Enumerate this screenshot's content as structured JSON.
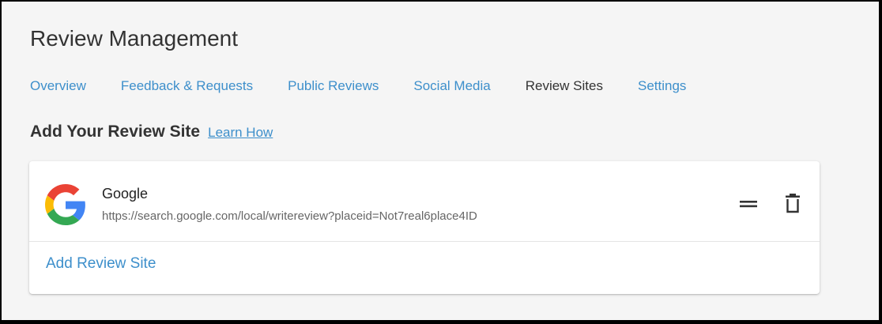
{
  "page": {
    "title": "Review Management"
  },
  "tabs": [
    {
      "label": "Overview",
      "active": false
    },
    {
      "label": "Feedback & Requests",
      "active": false
    },
    {
      "label": "Public Reviews",
      "active": false
    },
    {
      "label": "Social Media",
      "active": false
    },
    {
      "label": "Review Sites",
      "active": true
    },
    {
      "label": "Settings",
      "active": false
    }
  ],
  "section": {
    "title": "Add Your Review Site",
    "learn_link": "Learn How"
  },
  "review_sites": [
    {
      "name": "Google",
      "url": "https://search.google.com/local/writereview?placeid=Not7real6place4ID",
      "icon": "google-logo"
    }
  ],
  "actions": {
    "drag_icon": "drag-handle-icon",
    "delete_icon": "trash-icon",
    "add_label": "Add Review Site"
  },
  "colors": {
    "link": "#3d8fcb",
    "text": "#333333",
    "background": "#f5f5f5",
    "card": "#ffffff"
  }
}
